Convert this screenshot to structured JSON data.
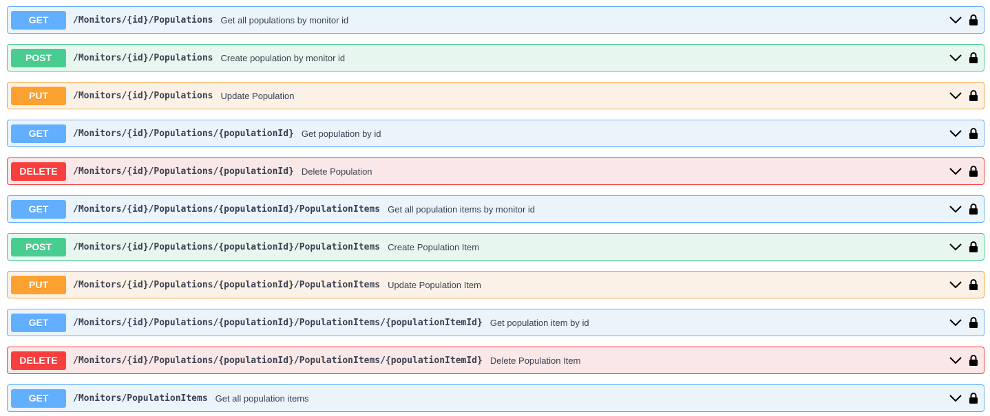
{
  "colors": {
    "get": "#61affe",
    "post": "#49cc90",
    "put": "#fca130",
    "delete": "#f93e3e",
    "get_bg": "#ebf3fb",
    "post_bg": "#e8f6f0",
    "put_bg": "#fbf1e6",
    "delete_bg": "#fae7e7",
    "text": "#3b4151"
  },
  "operations": [
    {
      "method": "GET",
      "path": "/Monitors/{id}/Populations",
      "summary": "Get all populations by monitor id",
      "expand_icon": "chevron-down-icon",
      "auth_icon": "lock-icon"
    },
    {
      "method": "POST",
      "path": "/Monitors/{id}/Populations",
      "summary": "Create population by monitor id",
      "expand_icon": "chevron-down-icon",
      "auth_icon": "lock-icon"
    },
    {
      "method": "PUT",
      "path": "/Monitors/{id}/Populations",
      "summary": "Update Population",
      "expand_icon": "chevron-down-icon",
      "auth_icon": "lock-icon"
    },
    {
      "method": "GET",
      "path": "/Monitors/{id}/Populations/{populationId}",
      "summary": "Get population by id",
      "expand_icon": "chevron-down-icon",
      "auth_icon": "lock-icon"
    },
    {
      "method": "DELETE",
      "path": "/Monitors/{id}/Populations/{populationId}",
      "summary": "Delete Population",
      "expand_icon": "chevron-down-icon",
      "auth_icon": "lock-icon"
    },
    {
      "method": "GET",
      "path": "/Monitors/{id}/Populations/{populationId}/PopulationItems",
      "summary": "Get all population items by monitor id",
      "expand_icon": "chevron-down-icon",
      "auth_icon": "lock-icon"
    },
    {
      "method": "POST",
      "path": "/Monitors/{id}/Populations/{populationId}/PopulationItems",
      "summary": "Create Population Item",
      "expand_icon": "chevron-down-icon",
      "auth_icon": "lock-icon"
    },
    {
      "method": "PUT",
      "path": "/Monitors/{id}/Populations/{populationId}/PopulationItems",
      "summary": "Update Population Item",
      "expand_icon": "chevron-down-icon",
      "auth_icon": "lock-icon"
    },
    {
      "method": "GET",
      "path": "/Monitors/{id}/Populations/{populationId}/PopulationItems/{populationItemId}",
      "summary": "Get population item by id",
      "expand_icon": "chevron-down-icon",
      "auth_icon": "lock-icon"
    },
    {
      "method": "DELETE",
      "path": "/Monitors/{id}/Populations/{populationId}/PopulationItems/{populationItemId}",
      "summary": "Delete Population Item",
      "expand_icon": "chevron-down-icon",
      "auth_icon": "lock-icon"
    },
    {
      "method": "GET",
      "path": "/Monitors/PopulationItems",
      "summary": "Get all population items",
      "expand_icon": "chevron-down-icon",
      "auth_icon": "lock-icon"
    }
  ]
}
